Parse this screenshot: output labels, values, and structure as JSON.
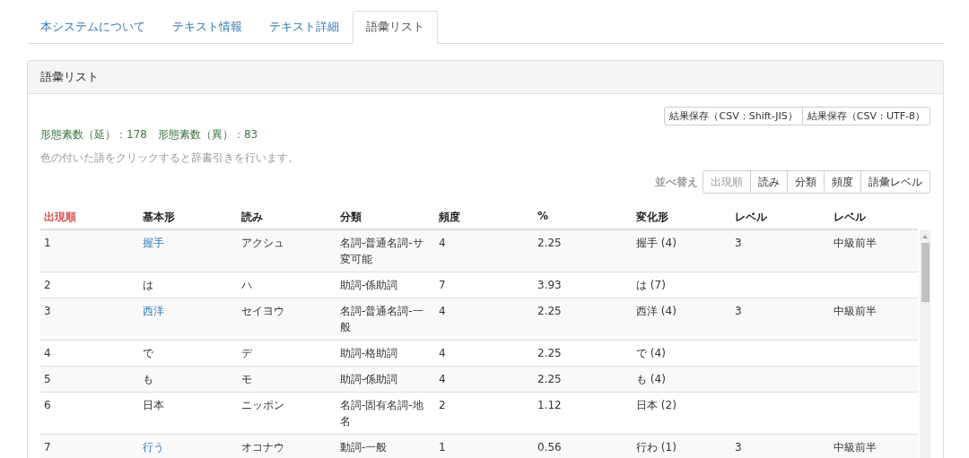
{
  "tabs": [
    {
      "label": "本システムについて",
      "selected": false
    },
    {
      "label": "テキスト情報",
      "selected": false
    },
    {
      "label": "テキスト詳細",
      "selected": false
    },
    {
      "label": "語彙リスト",
      "selected": true
    }
  ],
  "panel": {
    "title": "語彙リスト",
    "save_buttons": [
      "結果保存（CSV：Shift-JIS）",
      "結果保存（CSV：UTF-8）"
    ],
    "counts": "形態素数（延）：178　形態素数（異）：83",
    "hint": "色の付いた語をクリックすると辞書引きを行います。",
    "sort_label": "並べ替え",
    "sort_buttons": [
      {
        "label": "出現順",
        "selected": true
      },
      {
        "label": "読み",
        "selected": false
      },
      {
        "label": "分類",
        "selected": false
      },
      {
        "label": "頻度",
        "selected": false
      },
      {
        "label": "語彙レベル",
        "selected": false
      }
    ]
  },
  "table": {
    "columns": [
      {
        "label": "出現順",
        "sorted": true
      },
      {
        "label": "基本形",
        "sorted": false
      },
      {
        "label": "読み",
        "sorted": false
      },
      {
        "label": "分類",
        "sorted": false
      },
      {
        "label": "頻度",
        "sorted": false
      },
      {
        "label": "%",
        "sorted": false
      },
      {
        "label": "変化形",
        "sorted": false
      },
      {
        "label": "レベル",
        "sorted": false
      },
      {
        "label": "レベル",
        "sorted": false
      }
    ],
    "rows": [
      {
        "cells": [
          "1",
          "握手",
          "アクシュ",
          "名詞-普通名詞-サ変可能",
          "4",
          "2.25",
          "握手 (4)",
          "3",
          "中級前半"
        ],
        "linked": true
      },
      {
        "cells": [
          "2",
          "は",
          "ハ",
          "助詞-係助詞",
          "7",
          "3.93",
          "は (7)",
          "",
          ""
        ],
        "linked": false
      },
      {
        "cells": [
          "3",
          "西洋",
          "セイヨウ",
          "名詞-普通名詞-一般",
          "4",
          "2.25",
          "西洋 (4)",
          "3",
          "中級前半"
        ],
        "linked": true
      },
      {
        "cells": [
          "4",
          "で",
          "デ",
          "助詞-格助詞",
          "4",
          "2.25",
          "で (4)",
          "",
          ""
        ],
        "linked": false
      },
      {
        "cells": [
          "5",
          "も",
          "モ",
          "助詞-係助詞",
          "4",
          "2.25",
          "も (4)",
          "",
          ""
        ],
        "linked": false
      },
      {
        "cells": [
          "6",
          "日本",
          "ニッポン",
          "名詞-固有名詞-地名",
          "2",
          "1.12",
          "日本 (2)",
          "",
          ""
        ],
        "linked": false
      },
      {
        "cells": [
          "7",
          "行う",
          "オコナウ",
          "動詞-一般",
          "1",
          "0.56",
          "行わ (1)",
          "3",
          "中級前半"
        ],
        "linked": true
      }
    ]
  }
}
